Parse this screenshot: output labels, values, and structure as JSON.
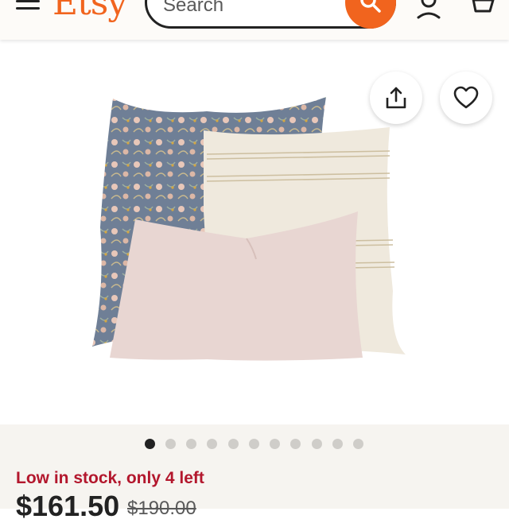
{
  "header": {
    "logo": "Etsy",
    "search_placeholder": "Search"
  },
  "gallery": {
    "image_count": 11,
    "active_index": 0
  },
  "listing": {
    "stock_text": "Low in stock, only 4 left",
    "price": "$161.50",
    "original_price": "$190.00"
  },
  "colors": {
    "brand": "#f1641e",
    "stock_alert": "#b3172d"
  },
  "icons": [
    "menu-icon",
    "search-icon",
    "user-icon",
    "cart-icon",
    "share-icon",
    "heart-icon"
  ]
}
